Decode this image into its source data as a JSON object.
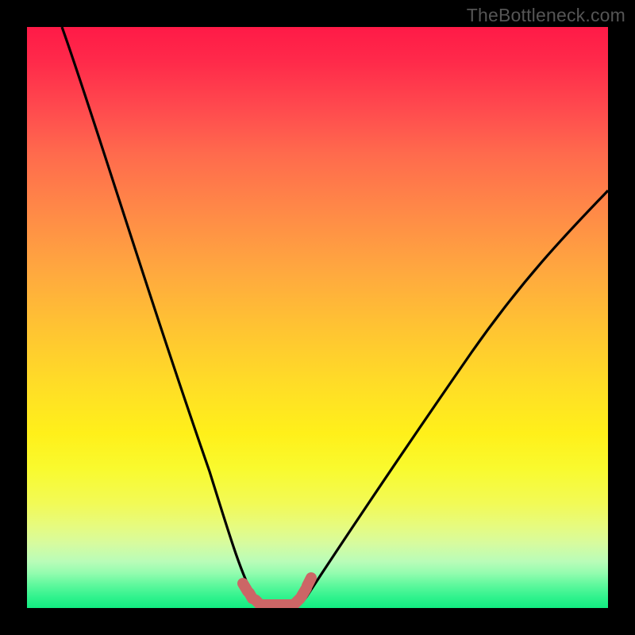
{
  "watermark": "TheBottleneck.com",
  "colors": {
    "background": "#000000",
    "curve": "#000000",
    "marker": "#cc6666",
    "gradient_top": "#ff1a47",
    "gradient_mid": "#ffde26",
    "gradient_bottom": "#12ec81"
  },
  "chart_data": {
    "type": "line",
    "title": "",
    "xlabel": "",
    "ylabel": "",
    "xlim": [
      0,
      100
    ],
    "ylim": [
      0,
      100
    ],
    "series": [
      {
        "name": "left-curve",
        "x": [
          6,
          10,
          15,
          20,
          25,
          30,
          33,
          35,
          37,
          39,
          40
        ],
        "y": [
          100,
          89,
          75,
          60,
          43,
          25,
          14,
          8,
          4,
          1,
          0
        ]
      },
      {
        "name": "right-curve",
        "x": [
          45,
          47,
          49,
          52,
          56,
          62,
          70,
          80,
          90,
          100
        ],
        "y": [
          0,
          1,
          3,
          7,
          13,
          23,
          35,
          49,
          61,
          72
        ]
      },
      {
        "name": "trough-markers",
        "x": [
          37,
          38,
          39,
          40,
          41,
          42,
          43,
          44,
          45,
          46,
          47
        ],
        "y": [
          4,
          2,
          1,
          0.5,
          0.3,
          0.3,
          0.3,
          0.5,
          0.8,
          1.2,
          2
        ]
      }
    ],
    "legend": false,
    "grid": false
  }
}
